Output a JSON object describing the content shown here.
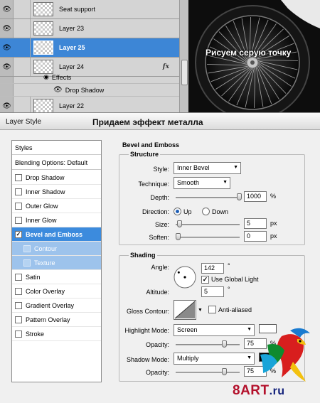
{
  "layers_panel": {
    "rows": [
      {
        "name": "Seat support",
        "selected": false,
        "has_fx": false
      },
      {
        "name": "Layer 23",
        "selected": false,
        "has_fx": false
      },
      {
        "name": "Layer 25",
        "selected": true,
        "has_fx": false
      },
      {
        "name": "Layer 24",
        "selected": false,
        "has_fx": true
      }
    ],
    "effects_label": "Effects",
    "drop_shadow_label": "Drop Shadow",
    "last_row": {
      "name": "Layer 22"
    },
    "fx_label": "fx",
    "eye_icon": "eye-icon"
  },
  "image": {
    "caption": "Рисуем серую точку"
  },
  "dialog": {
    "title": "Layer Style",
    "caption": "Придаем эффект металла",
    "styles": {
      "header": "Styles",
      "blending": "Blending Options: Default",
      "items": [
        {
          "label": "Drop Shadow",
          "checked": false,
          "state": "normal"
        },
        {
          "label": "Inner Shadow",
          "checked": false,
          "state": "normal"
        },
        {
          "label": "Outer Glow",
          "checked": false,
          "state": "normal"
        },
        {
          "label": "Inner Glow",
          "checked": false,
          "state": "normal"
        },
        {
          "label": "Bevel and Emboss",
          "checked": true,
          "state": "selected"
        },
        {
          "label": "Contour",
          "checked": false,
          "state": "sub"
        },
        {
          "label": "Texture",
          "checked": false,
          "state": "sub"
        },
        {
          "label": "Satin",
          "checked": false,
          "state": "normal"
        },
        {
          "label": "Color Overlay",
          "checked": false,
          "state": "normal"
        },
        {
          "label": "Gradient Overlay",
          "checked": false,
          "state": "normal"
        },
        {
          "label": "Pattern Overlay",
          "checked": false,
          "state": "normal"
        },
        {
          "label": "Stroke",
          "checked": false,
          "state": "normal"
        }
      ]
    },
    "bevel": {
      "title": "Bevel and Emboss",
      "structure_title": "Structure",
      "style_label": "Style:",
      "style_value": "Inner Bevel",
      "technique_label": "Technique:",
      "technique_value": "Smooth",
      "depth_label": "Depth:",
      "depth_value": "1000",
      "depth_unit": "%",
      "direction_label": "Direction:",
      "direction_up": "Up",
      "direction_down": "Down",
      "size_label": "Size:",
      "size_value": "5",
      "size_unit": "px",
      "soften_label": "Soften:",
      "soften_value": "0",
      "soften_unit": "px",
      "shading_title": "Shading",
      "angle_label": "Angle:",
      "angle_value": "142",
      "degree_sign": "°",
      "global_light_label": "Use Global Light",
      "global_light_checked": true,
      "altitude_label": "Altitude:",
      "altitude_value": "5",
      "gloss_label": "Gloss Contour:",
      "anti_aliased_label": "Anti-aliased",
      "highlight_mode_label": "Highlight Mode:",
      "highlight_mode_value": "Screen",
      "highlight_color": "#ffffff",
      "highlight_opacity_label": "Opacity:",
      "highlight_opacity_value": "75",
      "opacity_unit": "%",
      "shadow_mode_label": "Shadow Mode:",
      "shadow_mode_value": "Multiply",
      "shadow_color": "#000000",
      "shadow_opacity_label": "Opacity:",
      "shadow_opacity_value": "75"
    }
  },
  "watermark": {
    "main": "8ART",
    "suffix": ".ru"
  }
}
